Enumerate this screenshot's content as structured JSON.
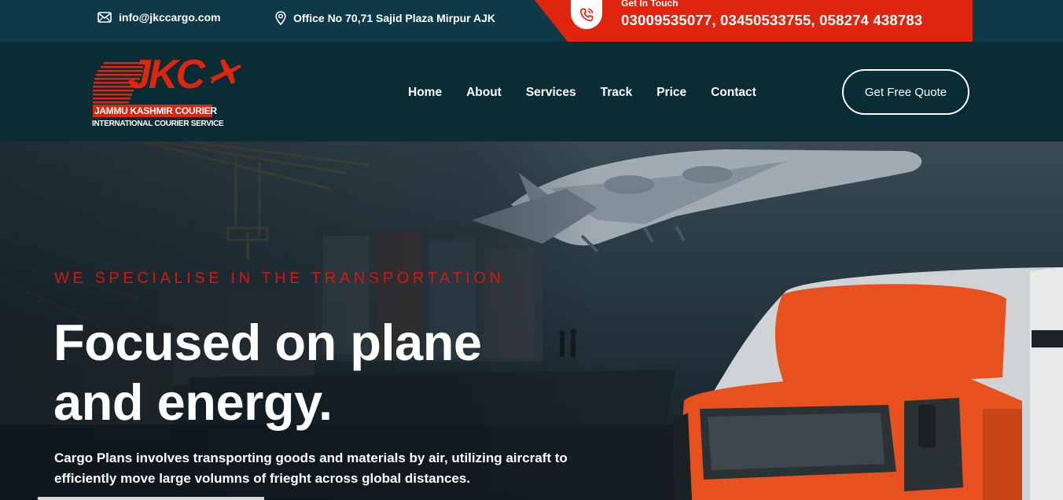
{
  "topbar": {
    "email": "info@jkccargo.com",
    "address": "Office No 70,71 Sajid Plaza Mirpur AJK",
    "contact_label": "Get In Touch",
    "phones": "03009535077, 03450533755, 058274 438783",
    "icons": [
      "envelope-icon",
      "map-pin-icon",
      "phone-icon"
    ]
  },
  "logo": {
    "letters": "JKC",
    "line1": "JAMMU KASHMIR COURIER",
    "line2": "INTERNATIONAL COURIER SERVICE"
  },
  "nav": {
    "items": [
      {
        "label": "Home"
      },
      {
        "label": "About"
      },
      {
        "label": "Services"
      },
      {
        "label": "Track"
      },
      {
        "label": "Price"
      },
      {
        "label": "Contact"
      }
    ],
    "cta": "Get Free Quote"
  },
  "hero": {
    "tagline": "WE SPECIALISE IN THE TRANSPORTATION",
    "headline_line1": "Focused on plane",
    "headline_line2": "and energy.",
    "description": "Cargo Plans involves transporting goods and materials by air, utilizing aircraft to efficiently move large volumns of frieght across global distances."
  },
  "colors": {
    "accent_red": "#e0250e",
    "topbar_bg": "#0e3a47",
    "header_bg": "#0a2c35",
    "truck_orange": "#e8501e"
  }
}
